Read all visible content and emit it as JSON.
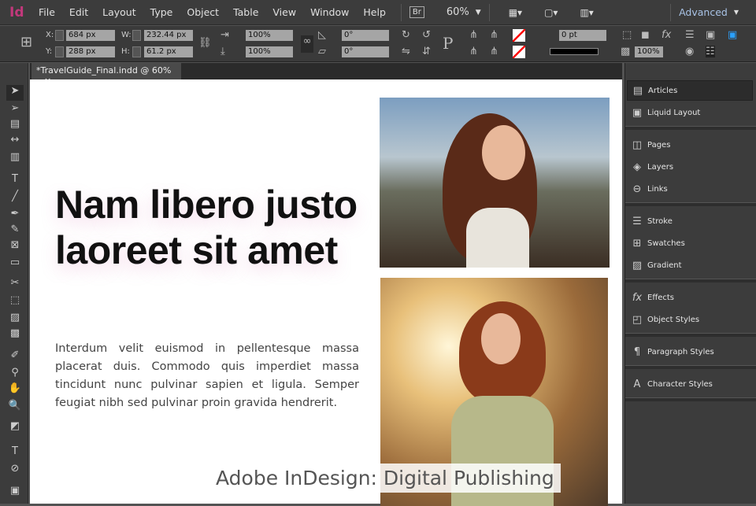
{
  "app": {
    "logo": "Id",
    "menus": [
      "File",
      "Edit",
      "Layout",
      "Type",
      "Object",
      "Table",
      "View",
      "Window",
      "Help"
    ],
    "bridge": "Br",
    "zoom": "60%",
    "workspace": "Advanced"
  },
  "control": {
    "x": "684 px",
    "y": "288 px",
    "w": "232.44 px",
    "h": "61.2 px",
    "scale_x": "100%",
    "scale_y": "100%",
    "rotate": "0°",
    "shear": "0°",
    "stroke_weight": "0 pt",
    "opacity": "100%",
    "labels": {
      "x": "X:",
      "y": "Y:",
      "w": "W:",
      "h": "H:"
    }
  },
  "tab": {
    "title": "*TravelGuide_Final.indd @ 60%",
    "close": "×"
  },
  "document": {
    "headline": "Nam libero justo laoreet sit amet",
    "body": "Interdum velit euismod in pellentesque massa placerat duis. Commodo quis imperdiet massa tincidunt nunc pulvinar sapien et ligula. Semper feugiat nibh sed pulvinar proin gravida hendrerit.",
    "caption": "Adobe InDesign: Digital Publishing"
  },
  "panels": [
    "Articles",
    "Liquid Layout",
    "Pages",
    "Layers",
    "Links",
    "Stroke",
    "Swatches",
    "Gradient",
    "Effects",
    "Object Styles",
    "Paragraph Styles",
    "Character Styles"
  ]
}
